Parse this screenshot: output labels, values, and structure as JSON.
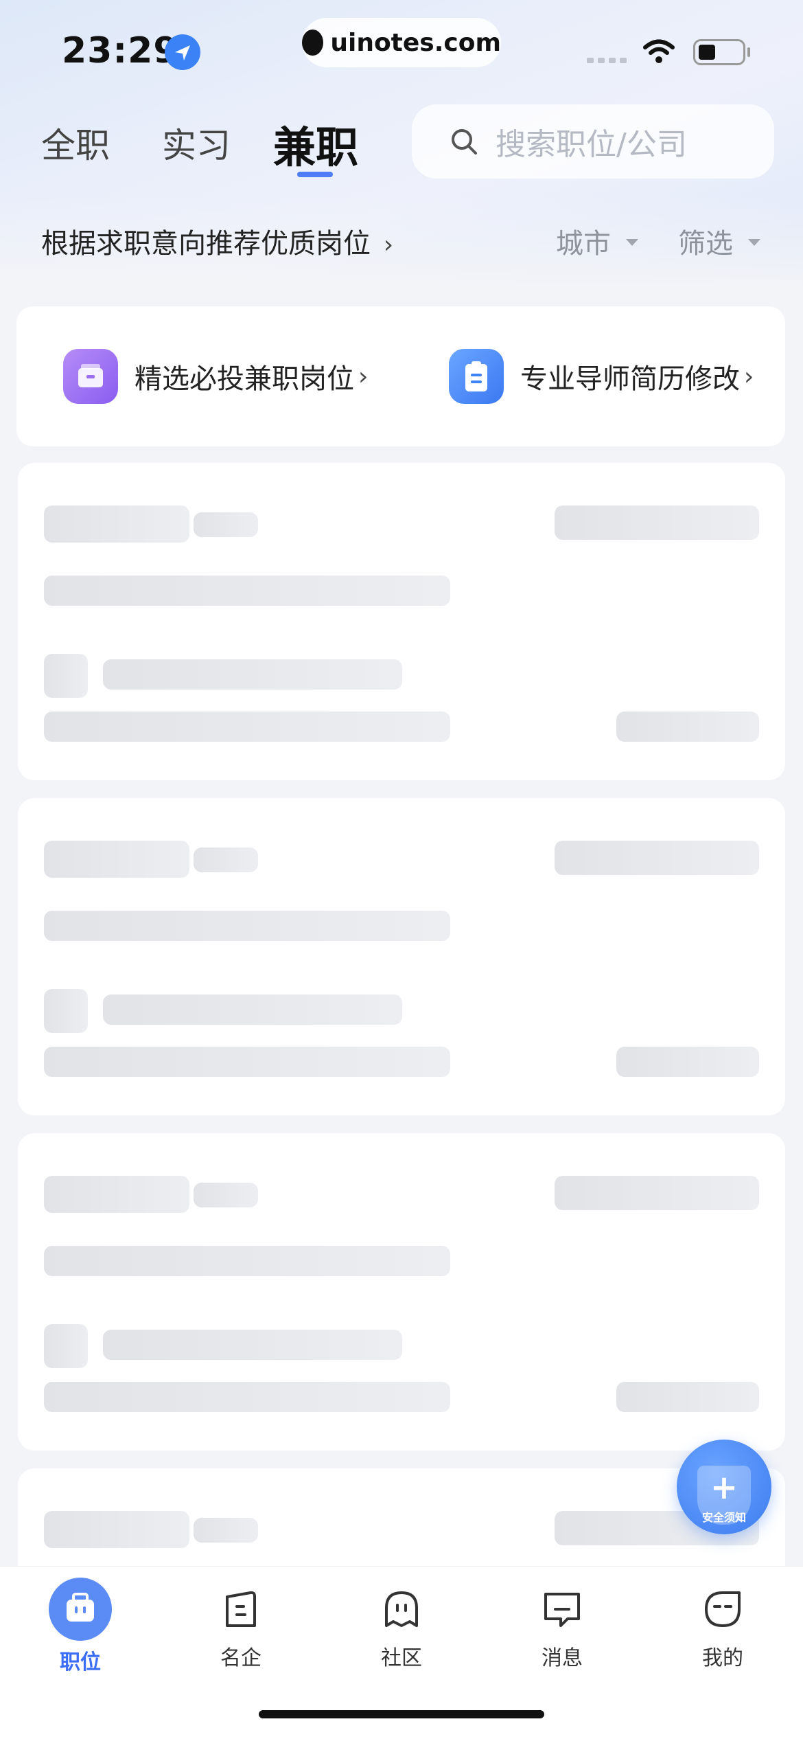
{
  "status_bar": {
    "time": "23:29",
    "site": "uinotes.com"
  },
  "tabs": [
    {
      "label": "全职",
      "active": false
    },
    {
      "label": "实习",
      "active": false
    },
    {
      "label": "兼职",
      "active": true
    }
  ],
  "search": {
    "placeholder": "搜索职位/公司"
  },
  "recommend_label": "根据求职意向推荐优质岗位",
  "filters": [
    {
      "label": "城市"
    },
    {
      "label": "筛选"
    }
  ],
  "quick_links": [
    {
      "label": "精选必投兼职岗位",
      "color": "#9a6cf0"
    },
    {
      "label": "专业导师简历修改",
      "color": "#3f83f8"
    }
  ],
  "fab": {
    "label": "安全须知"
  },
  "bottom_nav": [
    {
      "label": "职位",
      "active": true
    },
    {
      "label": "名企",
      "active": false
    },
    {
      "label": "社区",
      "active": false
    },
    {
      "label": "消息",
      "active": false
    },
    {
      "label": "我的",
      "active": false
    }
  ]
}
